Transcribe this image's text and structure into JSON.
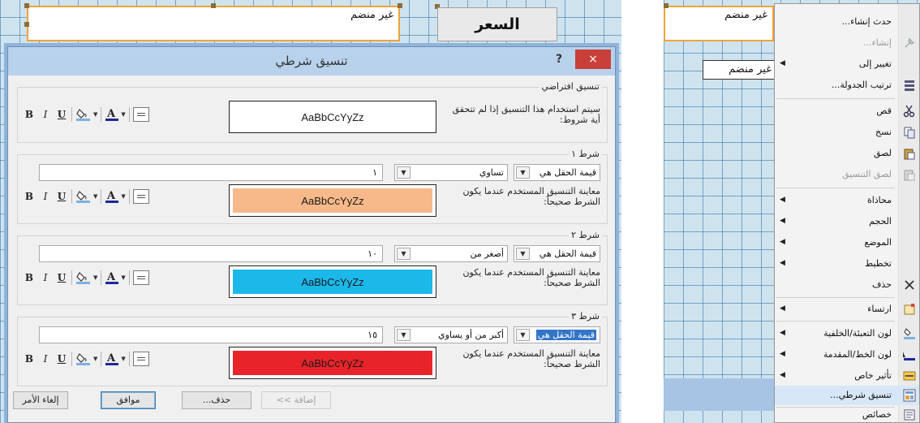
{
  "form": {
    "unbound_label": "غير منضم",
    "price_label": "السعر"
  },
  "dialog": {
    "title": "تنسيق شرطي",
    "help": "?",
    "close": "×",
    "default_section": {
      "title": "تنسيق افتراضي",
      "description": "سيتم استخدام هذا التنسيق إذا لم تتحقق أية شروط:",
      "preview_text": "AaBbCcYyZz",
      "preview_color": "#ffffff"
    },
    "toolbar": {
      "bold": "B",
      "italic": "I",
      "underline": "U"
    },
    "conditions": [
      {
        "title": "شرط ١",
        "field_mode": "قيمة الحقل هي",
        "operator": "تساوي",
        "value": "١",
        "description": "معاينة التنسيق المستخدم عندما يكون الشرط صحيحاً:",
        "preview_text": "AaBbCcYyZz",
        "preview_color": "#f7b98a"
      },
      {
        "title": "شرط ٢",
        "field_mode": "قيمة الحقل هي",
        "operator": "أصغر من",
        "value": "١٠",
        "description": "معاينة التنسيق المستخدم عندما يكون الشرط صحيحاً:",
        "preview_text": "AaBbCcYyZz",
        "preview_color": "#1cb8ea"
      },
      {
        "title": "شرط ٣",
        "field_mode": "قيمة الحقل هي",
        "operator": "أكبر من أو يساوي",
        "value": "١٥",
        "description": "معاينة التنسيق المستخدم عندما يكون الشرط صحيحاً:",
        "preview_text": "AaBbCcYyZz",
        "preview_color": "#e8242a"
      }
    ],
    "buttons": {
      "add": "إضافة >>",
      "delete": "حذف...",
      "ok": "موافق",
      "cancel": "إلغاء الأمر"
    }
  },
  "context_menu": {
    "items": [
      {
        "label": "حدث إنشاء...",
        "icon": "none",
        "disabled": false,
        "submenu": false
      },
      {
        "label": "إنشاء...",
        "icon": "build-icon",
        "disabled": true,
        "submenu": false
      },
      {
        "label": "تغيير إلى",
        "icon": "none",
        "disabled": false,
        "submenu": true
      },
      {
        "label": "ترتيب الجدولة...",
        "icon": "tab-order-icon",
        "disabled": false,
        "submenu": false
      },
      {
        "label": "قص",
        "icon": "scissors-icon",
        "disabled": false,
        "submenu": false
      },
      {
        "label": "نسخ",
        "icon": "copy-icon",
        "disabled": false,
        "submenu": false
      },
      {
        "label": "لصق",
        "icon": "paste-icon",
        "disabled": false,
        "submenu": false
      },
      {
        "label": "لصق التنسيق",
        "icon": "paste-format-icon",
        "disabled": true,
        "submenu": false
      },
      {
        "label": "محاذاة",
        "icon": "none",
        "disabled": false,
        "submenu": true
      },
      {
        "label": "الحجم",
        "icon": "none",
        "disabled": false,
        "submenu": true
      },
      {
        "label": "الموضع",
        "icon": "none",
        "disabled": false,
        "submenu": true
      },
      {
        "label": "تخطيط",
        "icon": "none",
        "disabled": false,
        "submenu": true
      },
      {
        "label": "حذف",
        "icon": "delete-x-icon",
        "disabled": false,
        "submenu": false
      },
      {
        "label": "ارتساء",
        "icon": "anchor-icon",
        "disabled": false,
        "submenu": true
      },
      {
        "label": "لون التعبئة/الخلفية",
        "icon": "fill-color-icon",
        "disabled": false,
        "submenu": true
      },
      {
        "label": "لون الخط/المقدمة",
        "icon": "font-color-icon",
        "disabled": false,
        "submenu": true
      },
      {
        "label": "تأثير خاص",
        "icon": "special-effect-icon",
        "disabled": false,
        "submenu": true
      },
      {
        "label": "تنسيق شرطي...",
        "icon": "conditional-format-icon",
        "disabled": false,
        "submenu": false,
        "highlight": true
      },
      {
        "label": "خصائص",
        "icon": "properties-icon",
        "disabled": false,
        "submenu": false
      }
    ]
  },
  "colors": {
    "accent_orange": "#f0a33a",
    "close_red": "#c9403a",
    "menu_highlight": "#d7e7f7"
  }
}
